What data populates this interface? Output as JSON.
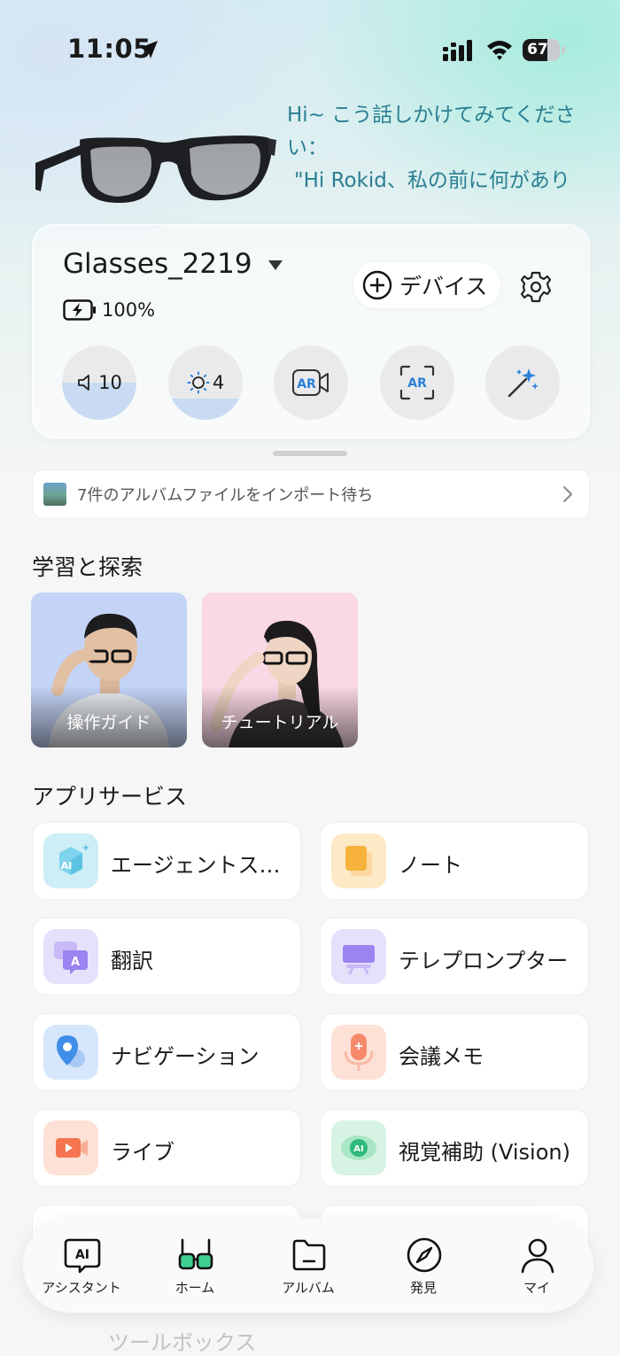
{
  "status_bar": {
    "time": "11:05",
    "battery_level": "67",
    "battery_fraction": 0.67
  },
  "prompt": {
    "line1": "Hi~ こう話しかけてみてくださ",
    "line2": "い：",
    "line3": "\"Hi Rokid、私の前に何があり"
  },
  "device": {
    "name": "Glasses_2219",
    "battery": "100%",
    "add_device_label": "デバイス",
    "controls": {
      "volume": {
        "value": "10",
        "level": 0.5
      },
      "brightness": {
        "value": "4",
        "level": 0.28
      }
    }
  },
  "import_notice": "7件のアルバムファイルをインポート待ち",
  "learn": {
    "title": "学習と探索",
    "cards": [
      {
        "label": "操作ガイド",
        "bg": "#c4d4f6"
      },
      {
        "label": "チュートリアル",
        "bg": "#fbd8e6"
      }
    ]
  },
  "services": {
    "title": "アプリサービス",
    "items": [
      {
        "label": "エージェントス…",
        "icon": "agent-store-icon",
        "color": "#cdeef7"
      },
      {
        "label": "ノート",
        "icon": "note-icon",
        "color": "#fde9c6"
      },
      {
        "label": "翻訳",
        "icon": "translate-icon",
        "color": "#e6e1fb"
      },
      {
        "label": "テレプロンプター",
        "icon": "teleprompter-icon",
        "color": "#e6e1fb"
      },
      {
        "label": "ナビゲーション",
        "icon": "navigation-icon",
        "color": "#d7e7fb"
      },
      {
        "label": "会議メモ",
        "icon": "meeting-memo-icon",
        "color": "#fde0d6"
      },
      {
        "label": "ライブ",
        "icon": "live-icon",
        "color": "#fde0d6"
      },
      {
        "label": "視覚補助 (Vision)",
        "icon": "vision-icon",
        "color": "#d6f3e4"
      }
    ]
  },
  "tabbar": {
    "items": [
      {
        "label": "アシスタント"
      },
      {
        "label": "ホーム"
      },
      {
        "label": "アルバム"
      },
      {
        "label": "発見"
      },
      {
        "label": "マイ"
      }
    ]
  },
  "toolbox_peek": "ツールボックス"
}
